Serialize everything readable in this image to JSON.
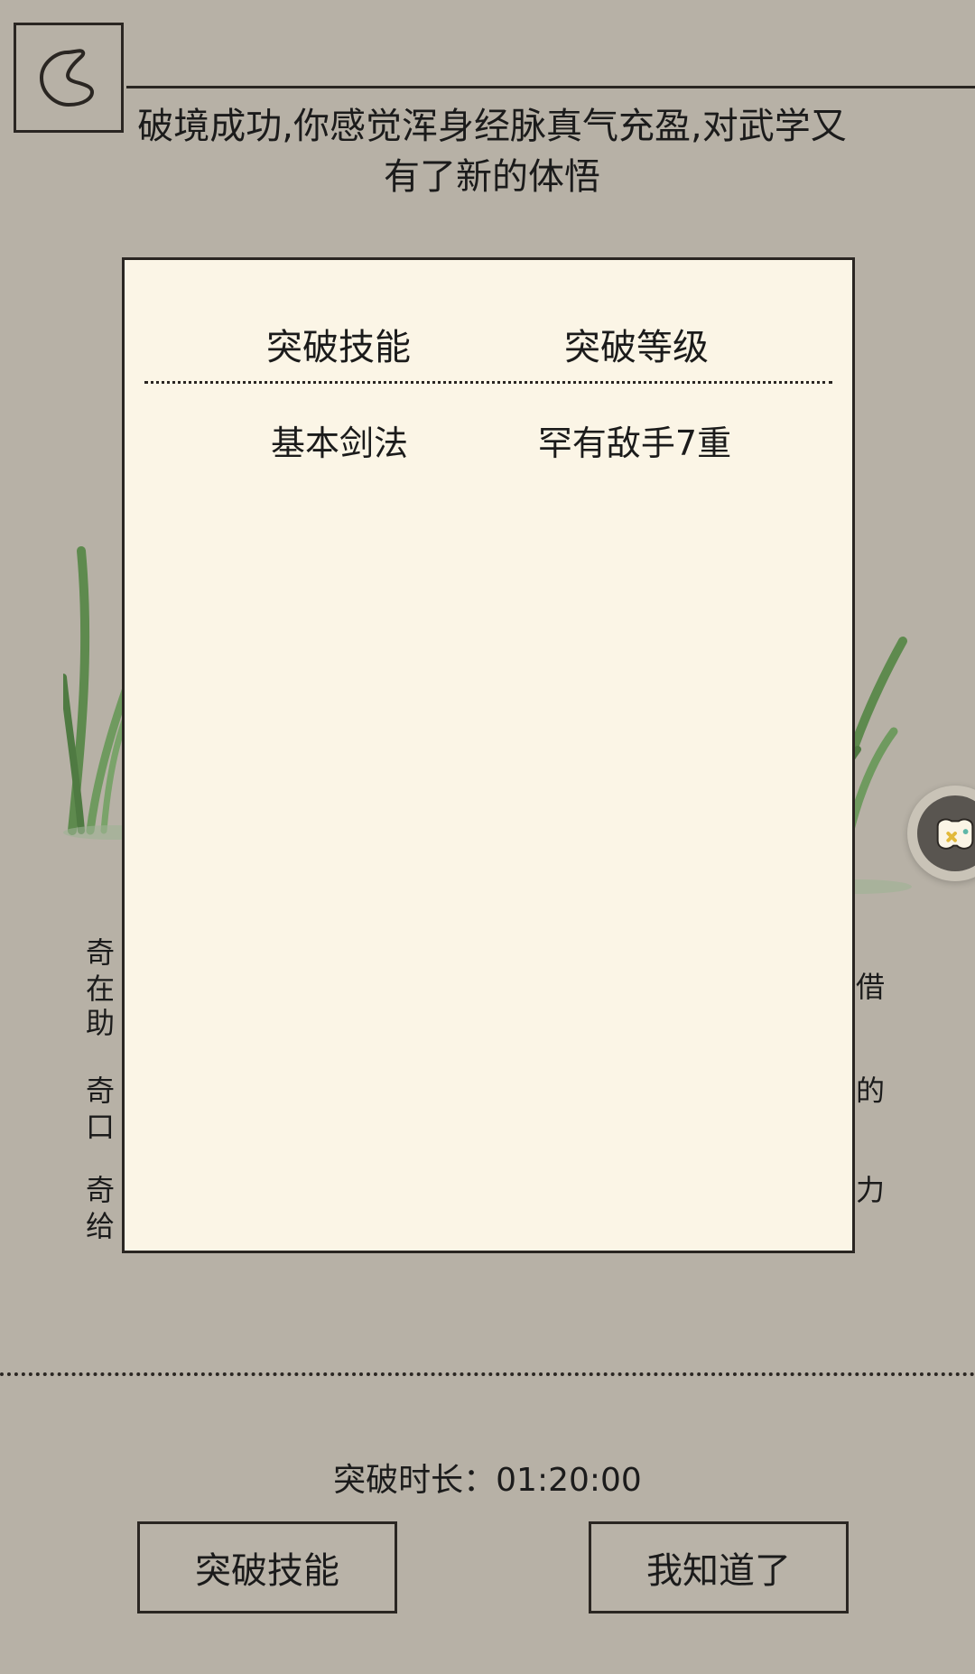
{
  "header": {
    "back_icon": "back-icon",
    "message": "破境成功,你感觉浑身经脉真气充盈,对武学又有了新的体悟"
  },
  "background_hints": [
    {
      "text": "奇"
    },
    {
      "text": "在"
    },
    {
      "text": "助"
    },
    {
      "text": "借"
    },
    {
      "text": "奇"
    },
    {
      "text": "的"
    },
    {
      "text": "口"
    },
    {
      "text": "奇"
    },
    {
      "text": "力"
    },
    {
      "text": "给"
    }
  ],
  "dialog": {
    "headers": [
      "突破技能",
      "突破等级"
    ],
    "rows": [
      {
        "skill": "基本剑法",
        "level": "罕有敌手7重"
      }
    ]
  },
  "footer": {
    "duration_label": "突破时长：",
    "duration_value": "01:20:00",
    "skills_button": "突破技能",
    "ok_button": "我知道了"
  },
  "float_assistant": {
    "icon": "game-controller-icon"
  },
  "colors": {
    "background": "#b7b1a6",
    "dialog": "#fbf5e6",
    "ink": "#1b1b1b",
    "grass": "#5e8a4e"
  }
}
